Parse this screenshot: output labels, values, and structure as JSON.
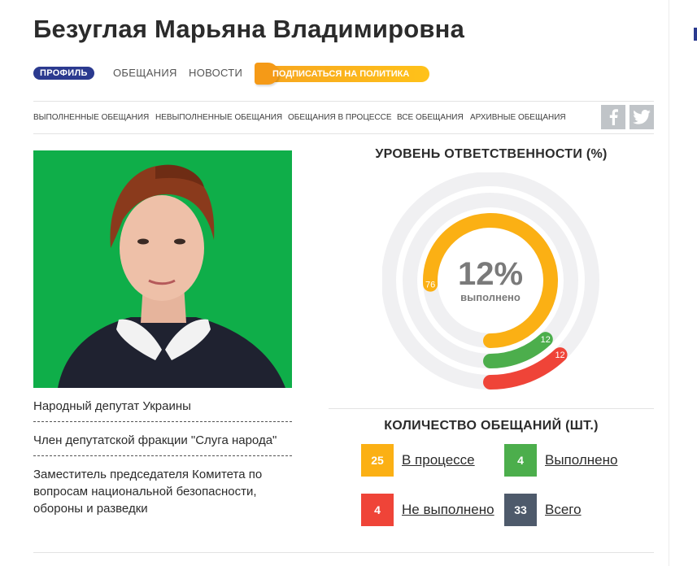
{
  "profile": {
    "name": "Безуглая Марьяна Владимировна"
  },
  "nav": {
    "tabs": [
      {
        "label": "Профиль",
        "active": true
      },
      {
        "label": "Обещания",
        "active": false
      },
      {
        "label": "Новости",
        "active": false
      }
    ],
    "subscribe_label": "Подписаться на политика"
  },
  "filters": {
    "links": [
      "Выполненные обещания",
      "Невыполненные обещания",
      "Обещания в процессе",
      "Все обещания",
      "Архивные обещания"
    ],
    "social": [
      "facebook-icon",
      "twitter-icon"
    ]
  },
  "positions": [
    "Народный депутат Украины",
    "Член депутатской фракции \"Слуга народа\"",
    "Заместитель председателя Комитета по вопросам национальной безопасности, обороны и разведки"
  ],
  "responsibility": {
    "title": "Уровень ответственности (%)",
    "center_value": "12%",
    "center_label": "выполнено",
    "chart_data": {
      "type": "pie",
      "series": [
        {
          "value": 76,
          "color": "#fbb014"
        },
        {
          "value": 12,
          "color": "#4cae4c"
        },
        {
          "value": 12,
          "color": "#ef4438"
        }
      ]
    }
  },
  "counts": {
    "title": "Количество обещаний (шт.)",
    "items": [
      {
        "value": "25",
        "label": "В процессе",
        "color": "#fbb014"
      },
      {
        "value": "4",
        "label": "Выполнено",
        "color": "#4cae4c"
      },
      {
        "value": "4",
        "label": "Не выполнено",
        "color": "#ef4438"
      },
      {
        "value": "33",
        "label": "Всего",
        "color": "#4e5a6b"
      }
    ]
  },
  "colors": {
    "accent": "#2b3a8f",
    "photo_bg": "#0fae49"
  }
}
